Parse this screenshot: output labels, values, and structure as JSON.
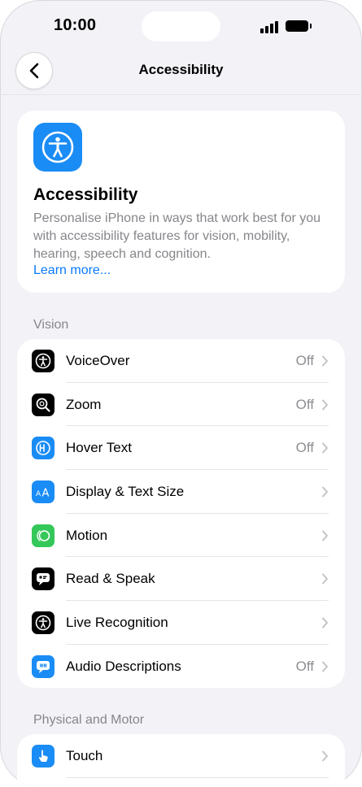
{
  "status_bar": {
    "time": "10:00"
  },
  "nav": {
    "title": "Accessibility"
  },
  "hero": {
    "title": "Accessibility",
    "description": "Personalise iPhone in ways that work best for you with accessibility features for vision, mobility, hearing, speech and cognition.",
    "link": "Learn more...",
    "icon": "accessibility-person-icon",
    "icon_color": "#1a8cf5"
  },
  "sections": [
    {
      "header": "Vision",
      "items": [
        {
          "label": "VoiceOver",
          "value": "Off",
          "icon": "voiceover-icon",
          "color": "#000000"
        },
        {
          "label": "Zoom",
          "value": "Off",
          "icon": "zoom-icon",
          "color": "#000000"
        },
        {
          "label": "Hover Text",
          "value": "Off",
          "icon": "hover-text-icon",
          "color": "#1a8cf5"
        },
        {
          "label": "Display & Text Size",
          "value": "",
          "icon": "text-size-icon",
          "color": "#1a8cf5"
        },
        {
          "label": "Motion",
          "value": "",
          "icon": "motion-icon",
          "color": "#34c759"
        },
        {
          "label": "Read & Speak",
          "value": "",
          "icon": "read-speak-icon",
          "color": "#000000"
        },
        {
          "label": "Live Recognition",
          "value": "",
          "icon": "live-recognition-icon",
          "color": "#000000"
        },
        {
          "label": "Audio Descriptions",
          "value": "Off",
          "icon": "audio-descriptions-icon",
          "color": "#1a8cf5"
        }
      ]
    },
    {
      "header": "Physical and Motor",
      "items": [
        {
          "label": "Touch",
          "value": "",
          "icon": "touch-icon",
          "color": "#1a8cf5"
        }
      ]
    }
  ]
}
